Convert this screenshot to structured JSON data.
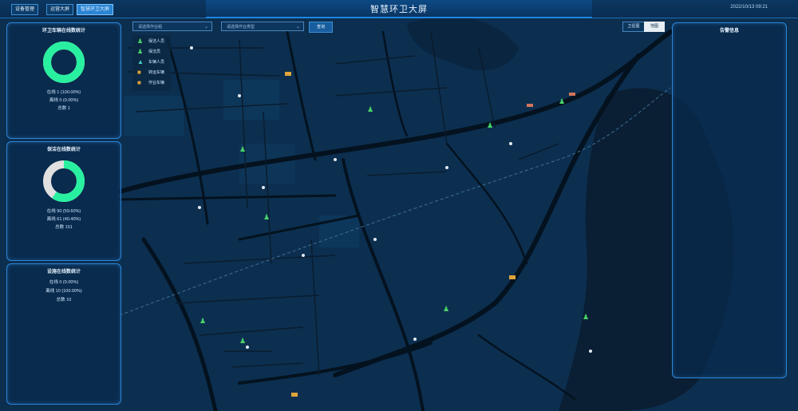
{
  "nav": {
    "buttons": [
      "设备管理",
      "运营大屏",
      "智慧环卫大屏"
    ],
    "active_index": 2
  },
  "header": {
    "title": "智慧环卫大屏",
    "datetime": "2022/10/13 09:21"
  },
  "filters": {
    "group_placeholder": "请选择作业组",
    "type_placeholder": "请选择作业类型",
    "query_label": "查询"
  },
  "map_toggle": {
    "options": [
      "卫星图",
      "地图"
    ],
    "active_index": 1
  },
  "legend": [
    {
      "label": "保洁人员",
      "icon": "walking-person-icon",
      "color": "#49d26a"
    },
    {
      "label": "保洁员",
      "icon": "walking-person-icon",
      "color": "#49d26a"
    },
    {
      "label": "车辆人员",
      "icon": "triangle-marker-icon",
      "color": "#49d2d2"
    },
    {
      "label": "转运车辆",
      "icon": "truck-icon",
      "color": "#e0a43a"
    },
    {
      "label": "作业车辆",
      "icon": "truck-icon",
      "color": "#e0a43a"
    }
  ],
  "panels": {
    "vehicle_online": {
      "title": "环卫车辆在线数统计",
      "lines": [
        "在线 1 (100.00%)",
        "离线 0 (0.00%)",
        "总数 1"
      ],
      "ratio": 1.0,
      "colors": {
        "on": "#29f0a0",
        "off": "#e0e0e0"
      }
    },
    "person_online": {
      "title": "保洁在线数统计",
      "lines": [
        "在线 90 (59.60%)",
        "离线 61 (40.40%)",
        "总数 151"
      ],
      "ratio": 0.596,
      "colors": {
        "on": "#29f0a0",
        "off": "#e0e0e0"
      }
    },
    "facility": {
      "title": "设施在线数统计",
      "lines": [
        "在线 0 (0.00%)",
        "离线 10 (100.00%)",
        "总数 10"
      ]
    },
    "right": {
      "title": "告警信息"
    }
  }
}
